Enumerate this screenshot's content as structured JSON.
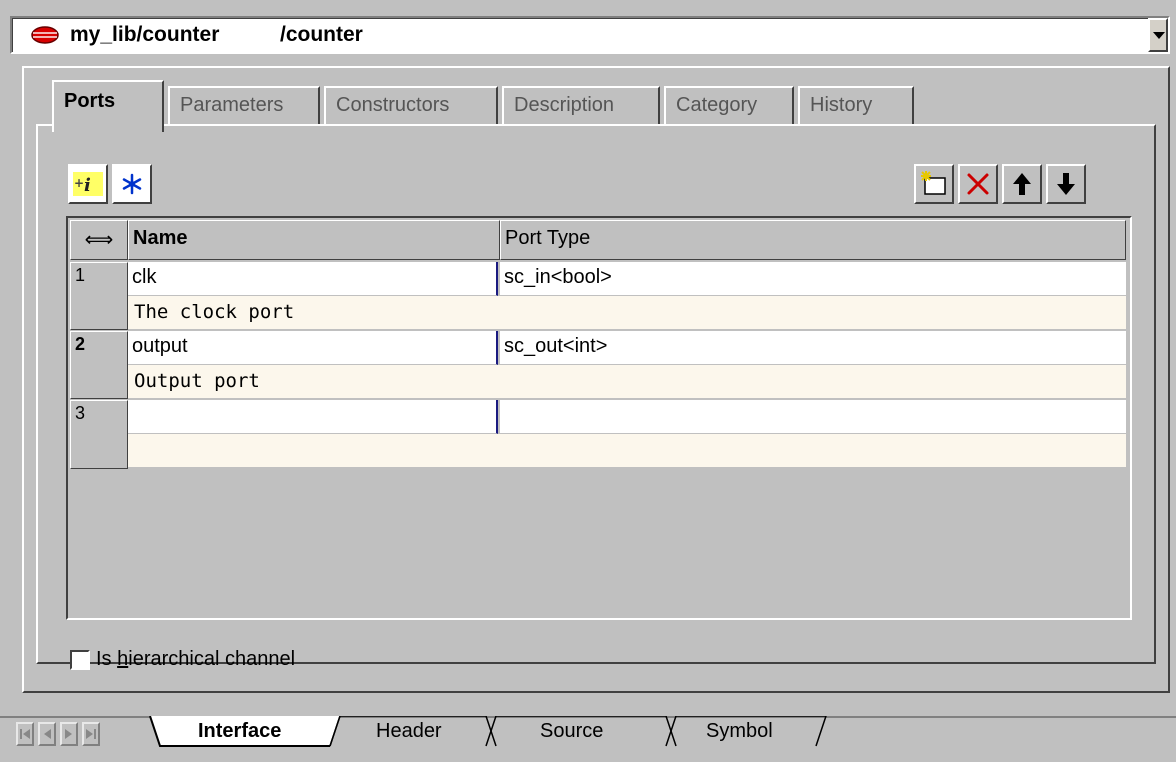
{
  "window": {
    "title": "my_lib/counter",
    "path": "/counter"
  },
  "tabs": [
    {
      "label": "Ports",
      "active": true
    },
    {
      "label": "Parameters",
      "active": false
    },
    {
      "label": "Constructors",
      "active": false
    },
    {
      "label": "Description",
      "active": false
    },
    {
      "label": "Category",
      "active": false
    },
    {
      "label": "History",
      "active": false
    }
  ],
  "toolbar": {
    "left_icons": [
      "add-info-icon",
      "freeze-icon"
    ],
    "right_icons": [
      "new-row-icon",
      "delete-icon",
      "move-up-icon",
      "move-down-icon"
    ],
    "delete_color": "#cc0000",
    "freeze_color": "#0033cc"
  },
  "table": {
    "resize_glyph": "⟺",
    "columns": [
      "Name",
      "Port Type"
    ],
    "rows": [
      {
        "index": "1",
        "name": "clk",
        "type": "sc_in<bool>",
        "description": "The clock port"
      },
      {
        "index": "2",
        "name": "output",
        "type": "sc_out<int>",
        "description": "Output port"
      },
      {
        "index": "3",
        "name": "",
        "type": "",
        "description": ""
      }
    ],
    "description_bg": "#fcf7ec"
  },
  "checkbox": {
    "label_pre": "Is ",
    "label_accel": "h",
    "label_post": "ierarchical channel",
    "checked": false
  },
  "bottom_tabs": [
    {
      "label": "Interface",
      "active": true
    },
    {
      "label": "Header",
      "active": false
    },
    {
      "label": "Source",
      "active": false
    },
    {
      "label": "Symbol",
      "active": false
    }
  ]
}
